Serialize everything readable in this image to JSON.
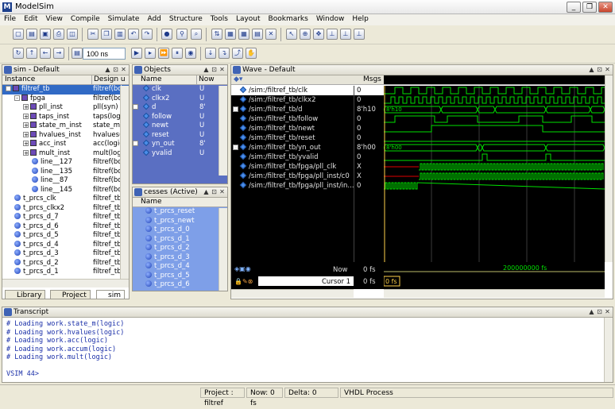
{
  "window": {
    "title": "ModelSim",
    "controls": [
      "minimize",
      "restore",
      "close"
    ]
  },
  "menu": [
    "File",
    "Edit",
    "View",
    "Compile",
    "Simulate",
    "Add",
    "Structure",
    "Tools",
    "Layout",
    "Bookmarks",
    "Window",
    "Help"
  ],
  "toolbar": {
    "run_length": "100 ns"
  },
  "sim_panel": {
    "title": "sim - Default",
    "col_instance": "Instance",
    "col_design": "Design u",
    "rows": [
      {
        "name": "filtref_tb",
        "design": "filtref(bd",
        "indent": 0,
        "expander": "-",
        "icon": "chip",
        "selected": true
      },
      {
        "name": "fpga",
        "design": "filtref(bd",
        "indent": 1,
        "expander": "-",
        "icon": "chip"
      },
      {
        "name": "pll_inst",
        "design": "pll(syn)",
        "indent": 2,
        "expander": "+",
        "icon": "chip"
      },
      {
        "name": "taps_inst",
        "design": "taps(logi",
        "indent": 2,
        "expander": "+",
        "icon": "chip"
      },
      {
        "name": "state_m_inst",
        "design": "state_m(",
        "indent": 2,
        "expander": "+",
        "icon": "chip"
      },
      {
        "name": "hvalues_inst",
        "design": "hvalues(l",
        "indent": 2,
        "expander": "+",
        "icon": "chip"
      },
      {
        "name": "acc_inst",
        "design": "acc(logic",
        "indent": 2,
        "expander": "+",
        "icon": "chip"
      },
      {
        "name": "mult_inst",
        "design": "mult(logi",
        "indent": 2,
        "expander": "+",
        "icon": "chip"
      },
      {
        "name": "line__127",
        "design": "filtref(bd",
        "indent": 3,
        "expander": "",
        "icon": "ball"
      },
      {
        "name": "line__135",
        "design": "filtref(bd",
        "indent": 3,
        "expander": "",
        "icon": "ball"
      },
      {
        "name": "line__87",
        "design": "filtref(bd",
        "indent": 3,
        "expander": "",
        "icon": "ball"
      },
      {
        "name": "line__145",
        "design": "filtref(bd",
        "indent": 3,
        "expander": "",
        "icon": "ball"
      },
      {
        "name": "t_prcs_clk",
        "design": "filtref_tb",
        "indent": 1,
        "expander": "",
        "icon": "ball"
      },
      {
        "name": "t_prcs_clkx2",
        "design": "filtref_tb",
        "indent": 1,
        "expander": "",
        "icon": "ball"
      },
      {
        "name": "t_prcs_d_7",
        "design": "filtref_tb",
        "indent": 1,
        "expander": "",
        "icon": "ball"
      },
      {
        "name": "t_prcs_d_6",
        "design": "filtref_tb",
        "indent": 1,
        "expander": "",
        "icon": "ball"
      },
      {
        "name": "t_prcs_d_5",
        "design": "filtref_tb",
        "indent": 1,
        "expander": "",
        "icon": "ball"
      },
      {
        "name": "t_prcs_d_4",
        "design": "filtref_tb",
        "indent": 1,
        "expander": "",
        "icon": "ball"
      },
      {
        "name": "t_prcs_d_3",
        "design": "filtref_tb",
        "indent": 1,
        "expander": "",
        "icon": "ball"
      },
      {
        "name": "t_prcs_d_2",
        "design": "filtref_tb",
        "indent": 1,
        "expander": "",
        "icon": "ball"
      },
      {
        "name": "t_prcs_d_1",
        "design": "filtref_tb",
        "indent": 1,
        "expander": "",
        "icon": "ball"
      }
    ],
    "tabs": [
      "Library",
      "Project",
      "sim"
    ]
  },
  "objects_panel": {
    "title": "Objects",
    "col_name": "Name",
    "col_now": "Now",
    "rows": [
      {
        "name": "clk",
        "value": "U",
        "expander": ""
      },
      {
        "name": "clkx2",
        "value": "U",
        "expander": ""
      },
      {
        "name": "d",
        "value": "8'",
        "expander": "+"
      },
      {
        "name": "follow",
        "value": "U",
        "expander": ""
      },
      {
        "name": "newt",
        "value": "U",
        "expander": ""
      },
      {
        "name": "reset",
        "value": "U",
        "expander": ""
      },
      {
        "name": "yn_out",
        "value": "8'",
        "expander": "+"
      },
      {
        "name": "yvalid",
        "value": "U",
        "expander": ""
      }
    ]
  },
  "processes_panel": {
    "title": "cesses (Active)",
    "col_name": "Name",
    "rows": [
      "t_prcs_reset",
      "t_prcs_newt",
      "t_prcs_d_0",
      "t_prcs_d_1",
      "t_prcs_d_2",
      "t_prcs_d_3",
      "t_prcs_d_4",
      "t_prcs_d_5",
      "t_prcs_d_6"
    ]
  },
  "wave_panel": {
    "title": "Wave - Default",
    "msgs_label": "Msgs",
    "signals": [
      {
        "name": "/sim:/filtref_tb/clk",
        "value": "0",
        "expander": "",
        "selected": true
      },
      {
        "name": "/sim:/filtref_tb/clkx2",
        "value": "0",
        "expander": ""
      },
      {
        "name": "/sim:/filtref_tb/d",
        "value": "8'h10",
        "expander": "+"
      },
      {
        "name": "/sim:/filtref_tb/follow",
        "value": "0",
        "expander": ""
      },
      {
        "name": "/sim:/filtref_tb/newt",
        "value": "0",
        "expander": ""
      },
      {
        "name": "/sim:/filtref_tb/reset",
        "value": "0",
        "expander": ""
      },
      {
        "name": "/sim:/filtref_tb/yn_out",
        "value": "8'h00",
        "expander": "+"
      },
      {
        "name": "/sim:/filtref_tb/yvalid",
        "value": "0",
        "expander": ""
      },
      {
        "name": "/sim:/filtref_tb/fpga/pll_clk",
        "value": "X",
        "expander": ""
      },
      {
        "name": "/sim:/filtref_tb/fpga/pll_inst/c0",
        "value": "X",
        "expander": ""
      },
      {
        "name": "/sim:/filtref_tb/fpga/pll_inst/in...",
        "value": "0",
        "expander": ""
      }
    ],
    "bus_labels": {
      "d": "8'h10",
      "yn_out": "8'h00"
    },
    "now_label": "Now",
    "now_value": "0 fs",
    "cursor_label": "Cursor 1",
    "cursor_value": "0 fs",
    "cursor_box": "0 fs",
    "timeline_label": "200000000 fs",
    "colors": {
      "wave": "#00e000",
      "bus": "#00e000",
      "unknown": "#e00000",
      "bg": "#000000",
      "grid": "#3a3a3a"
    }
  },
  "transcript": {
    "title": "Transcript",
    "lines": [
      "# Loading work.state_m(logic)",
      "# Loading work.hvalues(logic)",
      "# Loading work.acc(logic)",
      "# Loading work.accum(logic)",
      "# Loading work.mult(logic)"
    ],
    "prompt": "VSIM 44>"
  },
  "statusbar": {
    "project": "Project : filtref",
    "now": "Now: 0 fs",
    "delta": "Delta: 0",
    "process": "VHDL Process"
  }
}
